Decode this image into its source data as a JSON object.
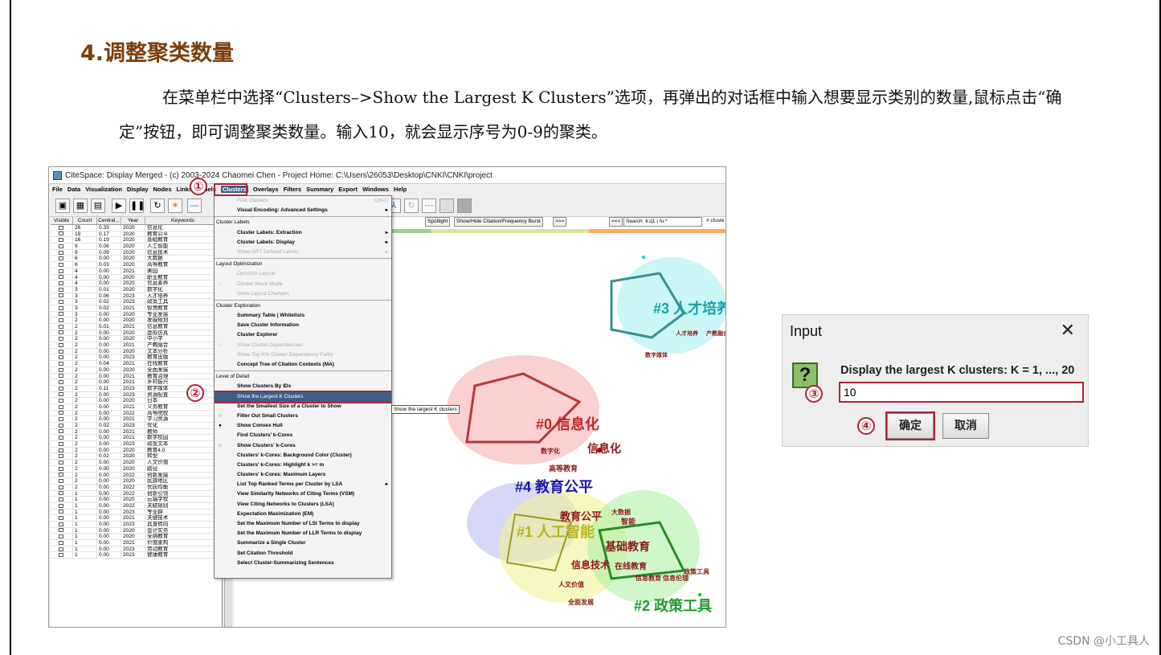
{
  "heading": "4.调整聚类数量",
  "paragraph": "在菜单栏中选择“Clusters–>Show the Largest K Clusters”选项，再弹出的对话框中输入想要显示类别的数量,鼠标点击“确定”按钮，即可调整聚类数量。输入10，就会显示序号为0-9的聚类。",
  "watermark": "CSDN @小工具人",
  "app": {
    "title": "CiteSpace: Display Merged - (c) 2003-2024 Chaomei Chen - Project Home: C:\\Users\\26053\\Desktop\\CNKI\\CNKI\\project",
    "menus": [
      "File",
      "Data",
      "Visualization",
      "Display",
      "Nodes",
      "Links",
      "Labels",
      "Clusters",
      "Overlays",
      "Filters",
      "Summary",
      "Export",
      "Windows",
      "Help"
    ],
    "active_menu": "Clusters",
    "table_headers": [
      "Visible",
      "Count",
      "Central...",
      "Year",
      "Keywords"
    ],
    "rows": [
      [
        "26",
        "0.33",
        "2020",
        "信息化"
      ],
      [
        "19",
        "0.17",
        "2020",
        "教育公平"
      ],
      [
        "16",
        "0.19",
        "2020",
        "基础教育"
      ],
      [
        "9",
        "0.06",
        "2020",
        "人工智能"
      ],
      [
        "9",
        "0.09",
        "2020",
        "信息技术"
      ],
      [
        "6",
        "0.00",
        "2020",
        "大数据"
      ],
      [
        "6",
        "0.03",
        "2020",
        "高等教育"
      ],
      [
        "4",
        "0.00",
        "2021",
        "美国"
      ],
      [
        "4",
        "0.00",
        "2020",
        "职业教育"
      ],
      [
        "4",
        "0.00",
        "2020",
        "信息素养"
      ],
      [
        "3",
        "0.01",
        "2020",
        "数字化"
      ],
      [
        "3",
        "0.06",
        "2023",
        "人才培养"
      ],
      [
        "3",
        "0.02",
        "2023",
        "政策工具"
      ],
      [
        "3",
        "0.02",
        "2021",
        "智慧教育"
      ],
      [
        "3",
        "0.00",
        "2020",
        "专业发展"
      ],
      [
        "2",
        "0.00",
        "2020",
        "发展规划"
      ],
      [
        "2",
        "0.01",
        "2021",
        "信息教育"
      ],
      [
        "2",
        "0.00",
        "2020",
        "虚拟仿真"
      ],
      [
        "2",
        "0.00",
        "2020",
        "中小学"
      ],
      [
        "2",
        "0.00",
        "2021",
        "产教融合"
      ],
      [
        "2",
        "0.00",
        "2020",
        "文本分析"
      ],
      [
        "2",
        "0.00",
        "2023",
        "教育出版"
      ],
      [
        "2",
        "0.04",
        "2021",
        "在线教育"
      ],
      [
        "2",
        "0.00",
        "2020",
        "全面发展"
      ],
      [
        "2",
        "0.00",
        "2021",
        "教育治理"
      ],
      [
        "2",
        "0.00",
        "2021",
        "乡村振兴"
      ],
      [
        "2",
        "0.11",
        "2023",
        "数字媒体"
      ],
      [
        "2",
        "0.00",
        "2023",
        "资源配置"
      ],
      [
        "2",
        "0.00",
        "2020",
        "日本"
      ],
      [
        "2",
        "0.00",
        "2021",
        "义务教育"
      ],
      [
        "2",
        "0.00",
        "2022",
        "高等院校"
      ],
      [
        "2",
        "0.00",
        "2021",
        "学习资源"
      ],
      [
        "2",
        "0.02",
        "2023",
        "优化"
      ],
      [
        "2",
        "0.00",
        "2021",
        "教师"
      ],
      [
        "2",
        "0.00",
        "2021",
        "数字校园"
      ],
      [
        "2",
        "0.00",
        "2023",
        "政策文本"
      ],
      [
        "2",
        "0.00",
        "2020",
        "教育4.0"
      ],
      [
        "2",
        "0.02",
        "2020",
        "转型"
      ],
      [
        "2",
        "0.00",
        "2020",
        "人文价值"
      ],
      [
        "2",
        "0.00",
        "2020",
        "路径"
      ],
      [
        "2",
        "0.00",
        "2022",
        "创新发展"
      ],
      [
        "2",
        "0.00",
        "2020",
        "民族地区"
      ],
      [
        "2",
        "0.00",
        "2022",
        "优质均衡"
      ],
      [
        "1",
        "0.00",
        "2022",
        "创新引领"
      ],
      [
        "1",
        "0.00",
        "2020",
        "云端学校"
      ],
      [
        "1",
        "0.00",
        "2022",
        "关联规则"
      ],
      [
        "1",
        "0.00",
        "2023",
        "专业群"
      ],
      [
        "1",
        "0.00",
        "2021",
        "关键技术"
      ],
      [
        "1",
        "0.00",
        "2023",
        "具身转向"
      ],
      [
        "1",
        "0.00",
        "2020",
        "会计实务"
      ],
      [
        "1",
        "0.00",
        "2020",
        "全纳教育"
      ],
      [
        "1",
        "0.00",
        "2021",
        "价值重构"
      ],
      [
        "1",
        "0.00",
        "2023",
        "劳动教育"
      ],
      [
        "1",
        "0.00",
        "2023",
        "健康教育"
      ]
    ],
    "canvas_controls": {
      "spotlight": "Spotlight",
      "toggle": "Show/Hide Citation/Frequency Burst",
      "next": ">>>",
      "prev": "<<<",
      "search": "Search: ti:q1 | fu:*",
      "cluster": "# cluste"
    },
    "clusters": [
      {
        "label": "#3 人才培养",
        "color": "#17a3a3"
      },
      {
        "label": "#0 信息化",
        "color": "#c0282a"
      },
      {
        "label": "#4 教育公平",
        "color": "#1a1aa8"
      },
      {
        "label": "#1 人工智能",
        "color": "#b6b61e"
      },
      {
        "label": "#2 政策工具",
        "color": "#1c9e2a"
      }
    ],
    "node_labels": [
      "人才培养",
      "产教融合",
      "数字媒体",
      "信息化",
      "教育公平",
      "高等教育",
      "数字化",
      "基础教育",
      "在线教育",
      "信息技术",
      "信息教育",
      "政策工具",
      "大数据",
      "智能",
      "人文价值",
      "全面发展",
      "信息伦理"
    ],
    "dropdown": [
      {
        "t": "Find Clusters",
        "type": "dis"
      },
      {
        "t": "Visual Encoding: Advanced Settings",
        "type": "b",
        "arrow": true
      },
      {
        "t": "Cluster Labels",
        "type": "hdr"
      },
      {
        "t": "Cluster Labels: Extraction",
        "type": "b",
        "arrow": true
      },
      {
        "t": "Cluster Labels: Display",
        "type": "b",
        "arrow": true
      },
      {
        "t": "Show GPT Defined Labels",
        "type": "dis",
        "arrow": true
      },
      {
        "t": "Layout Optimization",
        "type": "hdr"
      },
      {
        "t": "Optimize Layout",
        "type": "dis"
      },
      {
        "t": "Cluster Move Mode",
        "type": "dis",
        "radio": "○"
      },
      {
        "t": "Undo Layout Changes",
        "type": "dis"
      },
      {
        "t": "Cluster Exploration",
        "type": "hdr"
      },
      {
        "t": "Summary Table | Whitelists",
        "type": "b"
      },
      {
        "t": "Save Cluster Information",
        "type": "b"
      },
      {
        "t": "Cluster Explorer",
        "type": "b"
      },
      {
        "t": "Show Cluster Dependencies",
        "type": "dis",
        "radio": "○"
      },
      {
        "t": "Show Top K% Cluster Dependency Paths",
        "type": "dis"
      },
      {
        "t": "Concept Tree of Citation Contexts (MA)",
        "type": "b"
      },
      {
        "t": "Level of Detail",
        "type": "hdr"
      },
      {
        "t": "Show Clusters By IDs",
        "type": "b"
      },
      {
        "t": "Show the Largest K Clusters",
        "type": "sel"
      },
      {
        "t": "Set the Smallest Size of a Cluster to Show",
        "type": "b"
      },
      {
        "t": "Filter Out Small Clusters",
        "type": "b",
        "radio": "○"
      },
      {
        "t": "Show Convex Hull",
        "type": "b",
        "radio": "●"
      },
      {
        "t": "Find Clusters' k-Cores",
        "type": "b"
      },
      {
        "t": "Show Clusters' k-Cores",
        "type": "b",
        "radio": "○"
      },
      {
        "t": "Clusters' k-Cores: Background Color (Cluster)",
        "type": "b"
      },
      {
        "t": "Clusters' k-Cores: Highlight k >= m",
        "type": "b"
      },
      {
        "t": "Clusters' k-Cores: Maximum Layers",
        "type": "b"
      },
      {
        "t": "List Top Ranked Terms per Cluster by LSA",
        "type": "b",
        "arrow": true
      },
      {
        "t": "View Similarity Networks of Citing Terms (VSM)",
        "type": "b"
      },
      {
        "t": "View Citing Networks to Clusters (LSA)",
        "type": "b"
      },
      {
        "t": "Expectation Maximization (EM)",
        "type": "b"
      },
      {
        "t": "Set the Maximum Number of LSI Terms to display",
        "type": "b"
      },
      {
        "t": "Set the Maximum Number of LLR Terms to display",
        "type": "b"
      },
      {
        "t": "Summarize a Single Cluster",
        "type": "b"
      },
      {
        "t": "Set Citation Threshold",
        "type": "b"
      },
      {
        "t": "Select Cluster-Summarizing Sentences",
        "type": "b"
      }
    ],
    "tooltip": "Show the largest K clusters",
    "shortcut": "Ctrl-C"
  },
  "steps": [
    "①",
    "②",
    "③",
    "④"
  ],
  "dialog": {
    "title": "Input",
    "message": "Display the largest K clusters: K = 1, ..., 20",
    "value": "10",
    "ok": "确定",
    "cancel": "取消"
  }
}
